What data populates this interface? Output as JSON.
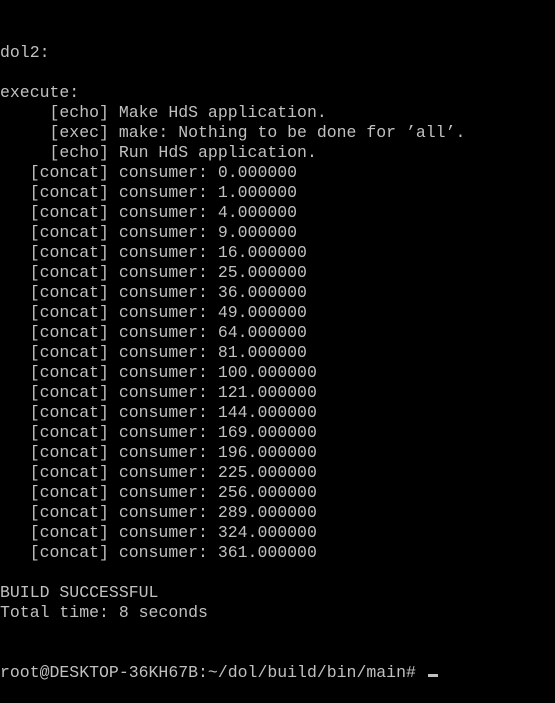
{
  "terminal": {
    "lines": [
      "dol2:",
      "",
      "execute:",
      "     [echo] Make HdS application.",
      "     [exec] make: Nothing to be done for ’all’.",
      "     [echo] Run HdS application.",
      "   [concat] consumer: 0.000000",
      "   [concat] consumer: 1.000000",
      "   [concat] consumer: 4.000000",
      "   [concat] consumer: 9.000000",
      "   [concat] consumer: 16.000000",
      "   [concat] consumer: 25.000000",
      "   [concat] consumer: 36.000000",
      "   [concat] consumer: 49.000000",
      "   [concat] consumer: 64.000000",
      "   [concat] consumer: 81.000000",
      "   [concat] consumer: 100.000000",
      "   [concat] consumer: 121.000000",
      "   [concat] consumer: 144.000000",
      "   [concat] consumer: 169.000000",
      "   [concat] consumer: 196.000000",
      "   [concat] consumer: 225.000000",
      "   [concat] consumer: 256.000000",
      "   [concat] consumer: 289.000000",
      "   [concat] consumer: 324.000000",
      "   [concat] consumer: 361.000000",
      "",
      "BUILD SUCCESSFUL",
      "Total time: 8 seconds"
    ],
    "prompt": "root@DESKTOP-36KH67B:~/dol/build/bin/main# ",
    "colors": {
      "background": "#000000",
      "foreground": "#c0c0c0"
    }
  }
}
